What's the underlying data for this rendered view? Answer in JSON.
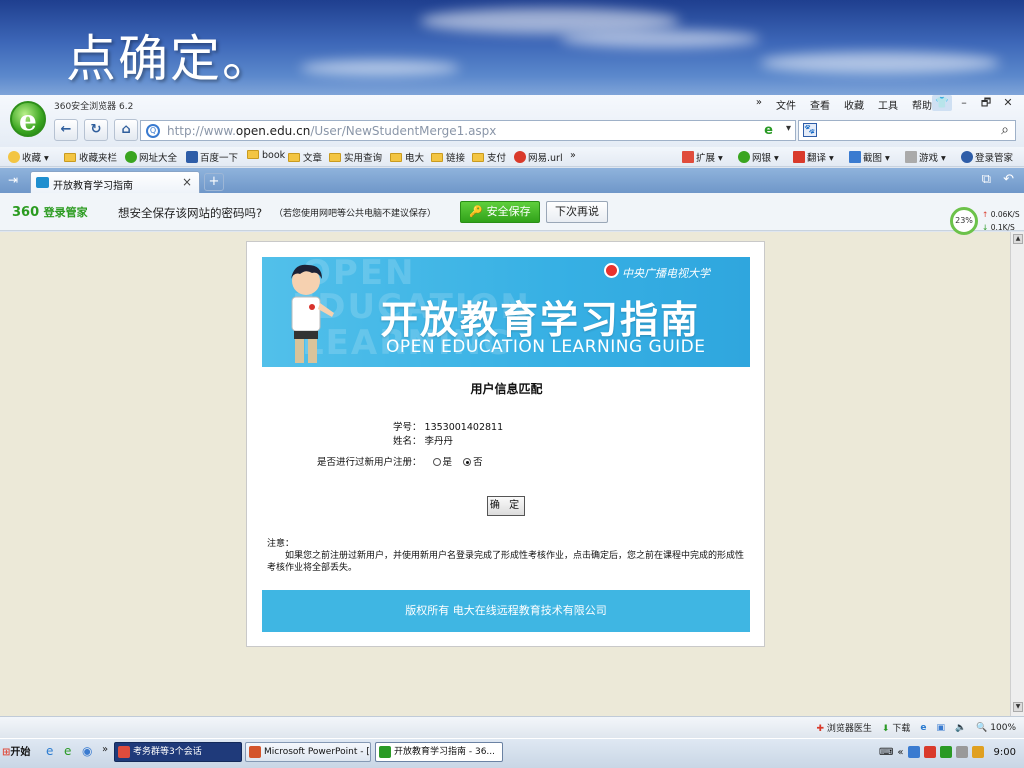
{
  "slide": {
    "title": "点确定。"
  },
  "browser": {
    "app_title": "360安全浏览器 6.2",
    "menu": [
      "»",
      "文件",
      "查看",
      "收藏",
      "工具",
      "帮助"
    ],
    "window_buttons": [
      "–",
      "🗗",
      "✕"
    ],
    "address": {
      "prefix": "http://www.",
      "domain": "open.edu.cn",
      "path": "/User/NewStudentMerge1.aspx"
    },
    "search_value": ""
  },
  "favorites": {
    "items": [
      {
        "label": "收藏",
        "kind": "star"
      },
      {
        "label": "收藏夹栏",
        "kind": "folder"
      },
      {
        "label": "网址大全",
        "kind": "green"
      },
      {
        "label": "百度一下",
        "kind": "paw"
      },
      {
        "label": "book",
        "kind": "folder"
      },
      {
        "label": "文章",
        "kind": "folder"
      },
      {
        "label": "实用查询",
        "kind": "folder"
      },
      {
        "label": "电大",
        "kind": "folder"
      },
      {
        "label": "链接",
        "kind": "folder"
      },
      {
        "label": "支付",
        "kind": "folder"
      },
      {
        "label": "网易.url",
        "kind": "red"
      }
    ],
    "more": "»",
    "right_items": [
      "扩展",
      "网银",
      "翻译",
      "截图",
      "游戏",
      "登录管家"
    ]
  },
  "tabs": [
    {
      "label": "开放教育学习指南",
      "close": "×"
    }
  ],
  "new_tab": "+",
  "password_bar": {
    "brand": "360",
    "brand_sub": "登录管家",
    "question": "想安全保存该网站的密码吗?",
    "note": "（若您使用网吧等公共电脑不建议保存）",
    "save_button": "安全保存",
    "later_button": "下次再说"
  },
  "speed": {
    "percent": "23%",
    "up": "0.06K/S",
    "down": "0.1K/S"
  },
  "page": {
    "banner": {
      "title": "开放教育学习指南",
      "subtitle": "OPEN EDUCATION LEARNING GUIDE",
      "university": "中央广播电视大学",
      "watermark_1": "OPEN",
      "watermark_2": "EDUCATION",
      "watermark_3": "LEARNING"
    },
    "heading": "用户信息匹配",
    "student_id_label": "学号：",
    "student_id": "1353001402811",
    "name_label": "姓名：",
    "name": "李丹丹",
    "registered_label": "是否进行过新用户注册：",
    "radio_yes": "是",
    "radio_no": "否",
    "radio_selected": "否",
    "confirm_button": "确 定",
    "notice_title": "注意：",
    "notice_text": "如果您之前注册过新用户，并使用新用户名登录完成了形成性考核作业，点击确定后，您之前在课程中完成的形成性考核作业将全部丢失。",
    "footer": "版权所有  电大在线远程教育技术有限公司"
  },
  "status_bar": {
    "doctor": "浏览器医生",
    "download": "下载",
    "zoom": "100%"
  },
  "taskbar": {
    "start": "开始",
    "more": "»",
    "tasks": [
      {
        "label": "考务群等3个会话",
        "style": "dark"
      },
      {
        "label": "Microsoft PowerPoint - [...",
        "style": "light"
      },
      {
        "label": "开放教育学习指南 - 36...",
        "style": "active"
      }
    ],
    "clock": "9:00"
  }
}
